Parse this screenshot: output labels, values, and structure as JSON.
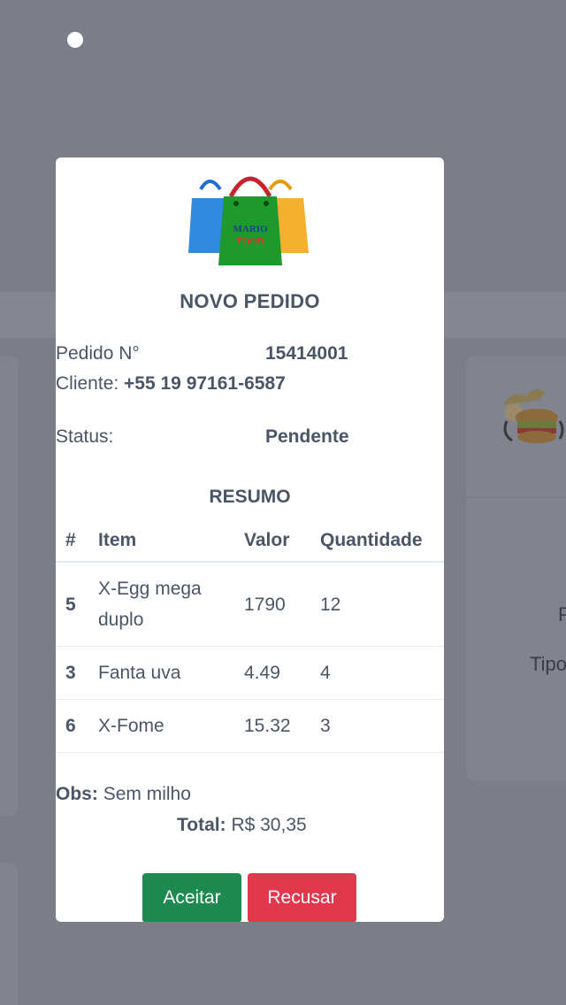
{
  "modal": {
    "logo_text_top": "MARIO",
    "logo_text_bottom": "FOOD",
    "title": "NOVO PEDIDO",
    "order_label": "Pedido N°",
    "order_number": "15414001",
    "client_label": "Cliente:",
    "client_phone": "+55 19 97161-6587",
    "status_label": "Status:",
    "status_value": "Pendente",
    "summary_title": "RESUMO",
    "table": {
      "headers": [
        "#",
        "Item",
        "Valor",
        "Quantidade"
      ],
      "rows": [
        {
          "num": "5",
          "item_line1": "X-Egg mega",
          "item_line2": "duplo",
          "value": "1790",
          "qty": "12"
        },
        {
          "num": "3",
          "item": "Fanta uva",
          "value": "4.49",
          "qty": "4"
        },
        {
          "num": "6",
          "item": "X-Fome",
          "value": "15.32",
          "qty": "3"
        }
      ]
    },
    "obs_label": "Obs:",
    "obs_value": "Sem milho",
    "total_label": "Total:",
    "total_value": "R$ 30,35",
    "accept_label": "Aceitar",
    "refuse_label": "Recusar"
  },
  "background": {
    "right_card_text_1": "P",
    "right_card_text_2": "Tipo"
  },
  "colors": {
    "accept": "#1e8a4f",
    "refuse": "#e0394e",
    "overlay": "#7b7e88",
    "text": "#4a5568"
  }
}
